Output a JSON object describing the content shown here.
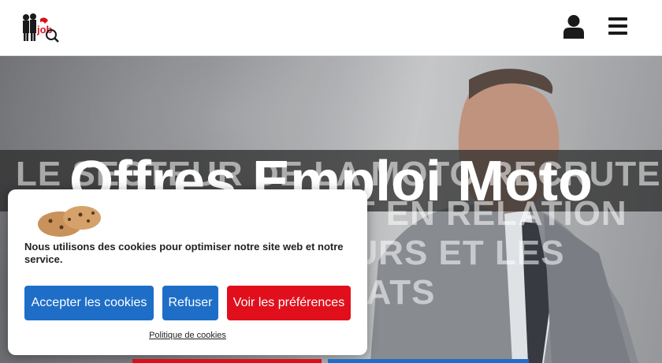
{
  "header": {
    "logo_alt": "logo",
    "user_icon": "user-icon",
    "menu_icon": "hamburger-menu-icon"
  },
  "hero": {
    "background_lines": [
      "LE SECTEUR DE LA MOTO RECRUTE",
      "EMPLOI MOTO MET EN RELATION",
      "LES EMPLOYEURS ET LES",
      "CANDIDATS"
    ],
    "title": "Offres Emploi Moto"
  },
  "cookie_banner": {
    "message": "Nous utilisons des cookies pour optimiser notre site web et notre service.",
    "accept_label": "Accepter les cookies",
    "refuse_label": "Refuser",
    "preferences_label": "Voir les préférences",
    "policy_link": "Politique de cookies"
  },
  "colors": {
    "accent_blue": "#1e6ec8",
    "accent_red": "#e10f1c",
    "header_bg": "#ffffff"
  }
}
